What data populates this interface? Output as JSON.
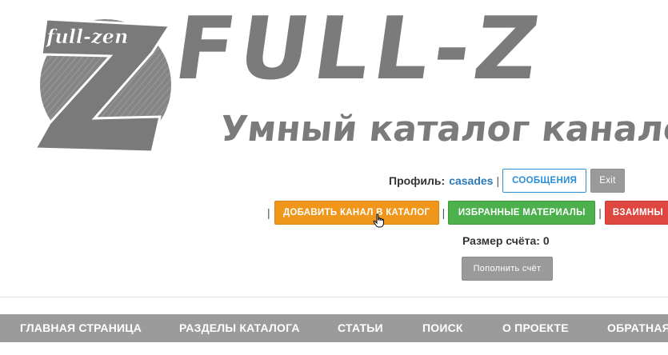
{
  "logo": {
    "badge_text": "full-zen",
    "title": "FULL-Z",
    "subtitle": "Умный каталог каналов"
  },
  "profile": {
    "label": "Профиль:",
    "username": "casades",
    "separator": "|",
    "messages_label": "СООБЩЕНИЯ",
    "exit_label": "Exit"
  },
  "actions": {
    "separator": "|",
    "add_channel_label": "ДОБАВИТЬ КАНАЛ В КАТАЛОГ",
    "favorites_label": "ИЗБРАННЫЕ МАТЕРИАЛЫ",
    "mutual_label": "ВЗАИМНЫ"
  },
  "account": {
    "balance_text": "Размер счёта: 0",
    "topup_label": "Пополнить счёт"
  },
  "nav": {
    "items": [
      {
        "label": "ГЛАВНАЯ СТРАНИЦА"
      },
      {
        "label": "РАЗДЕЛЫ КАТАЛОГА"
      },
      {
        "label": "СТАТЬИ"
      },
      {
        "label": "ПОИСК"
      },
      {
        "label": "О ПРОЕКТЕ"
      },
      {
        "label": "ОБРАТНАЯ"
      }
    ]
  },
  "colors": {
    "logo_gray": "#7b7b7b",
    "link_blue": "#2a7ab8",
    "orange": "#f0961a",
    "green": "#4cb04c",
    "red": "#de4640",
    "nav_gray": "#9b9b9b"
  }
}
